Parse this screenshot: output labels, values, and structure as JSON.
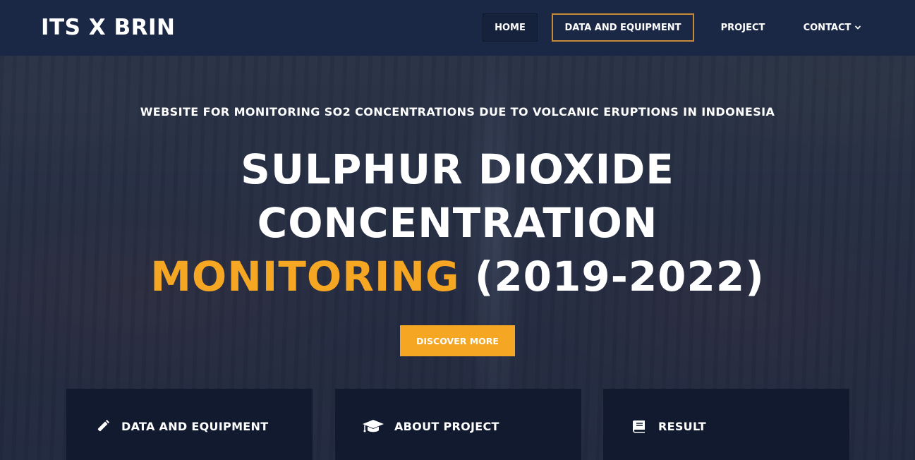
{
  "header": {
    "brand": "ITS X BRIN",
    "nav": {
      "home": "HOME",
      "data_equipment": "DATA AND EQUIPMENT",
      "project": "PROJECT",
      "contact": "CONTACT"
    },
    "active_item": "DATA AND EQUIPMENT"
  },
  "hero": {
    "subtitle": "WEBSITE FOR MONITORING SO2 CONCENTRATIONS DUE TO VOLCANIC ERUPTIONS IN INDONESIA",
    "title_line1": "SULPHUR DIOXIDE",
    "title_line2": "CONCENTRATION",
    "title_line3_accent": "MONITORING",
    "title_line3_rest": " (2019-2022)",
    "cta_label": "DISCOVER MORE"
  },
  "cards": [
    {
      "title": "DATA AND EQUIPMENT",
      "icon": "pencil-icon"
    },
    {
      "title": "ABOUT PROJECT",
      "icon": "graduation-cap-icon"
    },
    {
      "title": "RESULT",
      "icon": "book-icon"
    }
  ],
  "colors": {
    "navbar_bg": "#1b2845",
    "accent": "#f5a623",
    "active_border": "#c58a3a",
    "card_bg": "#121a30",
    "text": "#ffffff"
  }
}
